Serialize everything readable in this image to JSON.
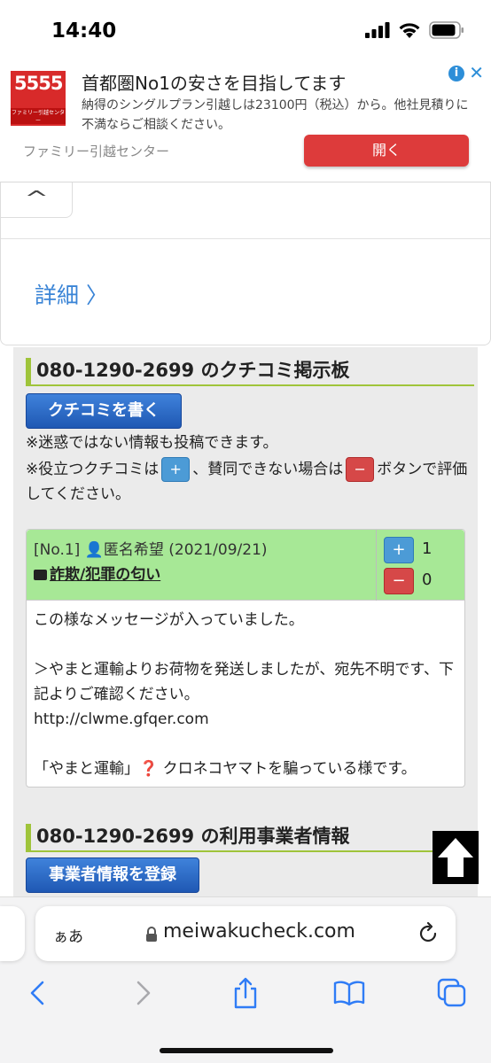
{
  "status_bar": {
    "time": "14:40"
  },
  "ad": {
    "logo_text_top": "5555",
    "logo_text_sub": "ファミリー引越センター",
    "title": "首都圏No1の安さを目指してます",
    "description": "納得のシングルプラン引越しは23100円（税込）から。他社見積りに不満ならご相談ください。",
    "advertiser": "ファミリー引越センター",
    "open_label": "開く",
    "info_icon": "i",
    "close_icon": "✕"
  },
  "details": {
    "collapse_icon": "^",
    "link_label": "詳細 〉"
  },
  "board": {
    "title": "080-1290-2699 のクチコミ掲示板",
    "write_button": "クチコミを書く",
    "notice1": "※迷惑ではない情報も投稿できます。",
    "notice2_pre": "※役立つクチコミは",
    "notice2_mid": "、賛同できない場合は",
    "notice2_post": "ボタンで評価してください。",
    "plus": "+",
    "minus": "−"
  },
  "review": {
    "meta": "[No.1] 👤匿名希望 (2021/09/21)",
    "category": "詐欺/犯罪の匂い",
    "upvotes": "1",
    "downvotes": "0",
    "lines": [
      "この様なメッセージが入っていました。",
      "",
      "＞やまと運輸よりお荷物を発送しましたが、宛先不明です、下記よりご確認ください。",
      "http://clwme.gfqer.com",
      "",
      "「やまと運輸」❓ クロネコヤマトを騙っている様です。"
    ]
  },
  "operator": {
    "title": "080-1290-2699 の利用事業者情報",
    "register_button": "事業者情報を登録"
  },
  "safari": {
    "aa_label": "ぁあ",
    "url": "meiwakucheck.com"
  }
}
